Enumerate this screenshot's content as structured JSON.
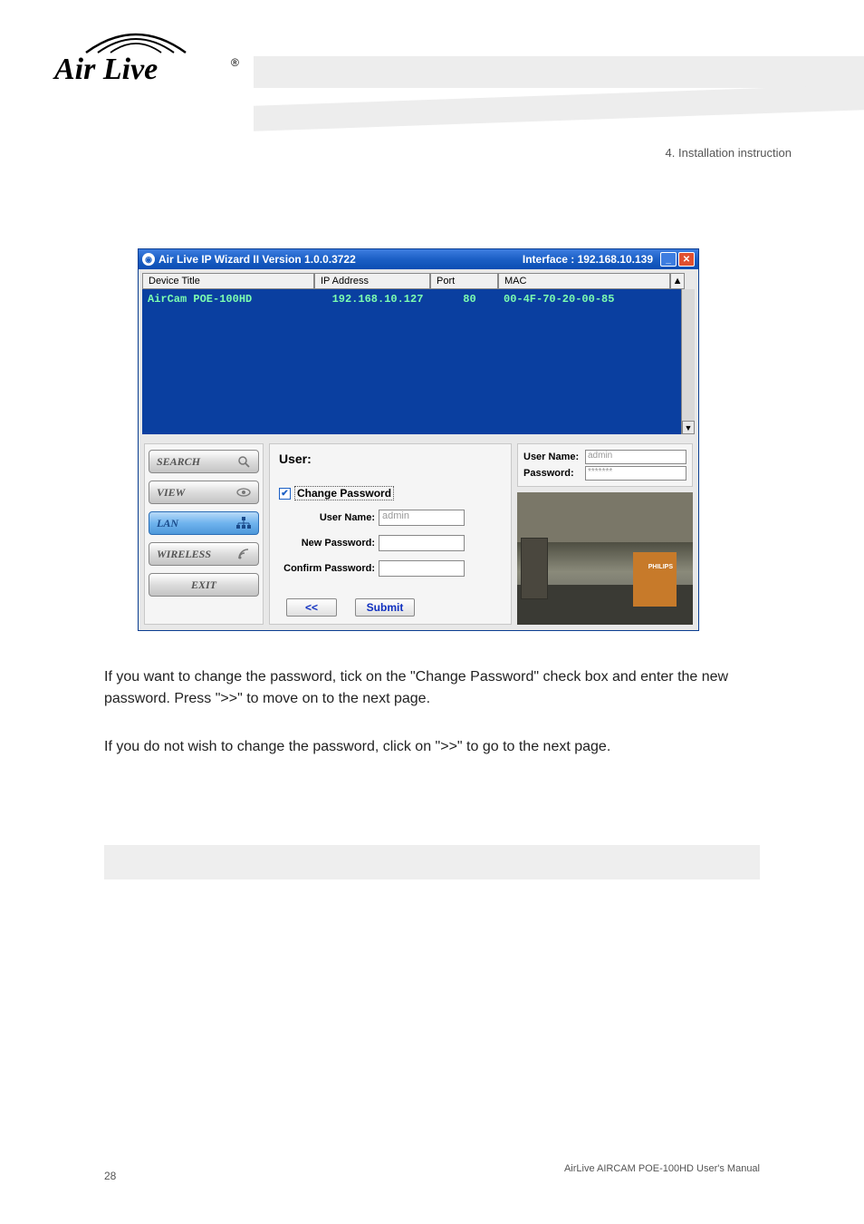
{
  "page": {
    "number": "28",
    "chapter_label": "4. Installation instruction",
    "footer_line1": "AirLive AIRCAM POE-100HD User's Manual",
    "footer_line2": ""
  },
  "body": {
    "para1": "If you want to change the password, tick on the \"Change Password\" check box and enter the new password. Press \">>\" to move on to the next page.",
    "para2": "If you do not wish to change the password, click on \">>\" to go to the next page."
  },
  "window": {
    "title": "Air Live IP Wizard II  Version 1.0.0.3722",
    "interface_label": "Interface : 192.168.10.139",
    "columns": {
      "device_title": "Device Title",
      "ip_address": "IP Address",
      "port": "Port",
      "mac": "MAC"
    },
    "rows": [
      {
        "device_title": "AirCam POE-100HD",
        "ip_address": "192.168.10.127",
        "port": "80",
        "mac": "00-4F-70-20-00-85"
      }
    ],
    "sidebar": {
      "search": "SEARCH",
      "view": "VIEW",
      "lan": "LAN",
      "wireless": "WIRELESS",
      "exit": "EXIT"
    },
    "center": {
      "heading": "User:",
      "change_pw_label": "Change Password",
      "username_label": "User Name:",
      "username_value": "admin",
      "newpw_label": "New Password:",
      "confirmpw_label": "Confirm Password:",
      "back_btn": "<<",
      "submit_btn": "Submit"
    },
    "login": {
      "username_label": "User Name:",
      "username_value": "admin",
      "password_label": "Password:",
      "password_value": "*******"
    },
    "preview_box_label": "PHILIPS"
  }
}
